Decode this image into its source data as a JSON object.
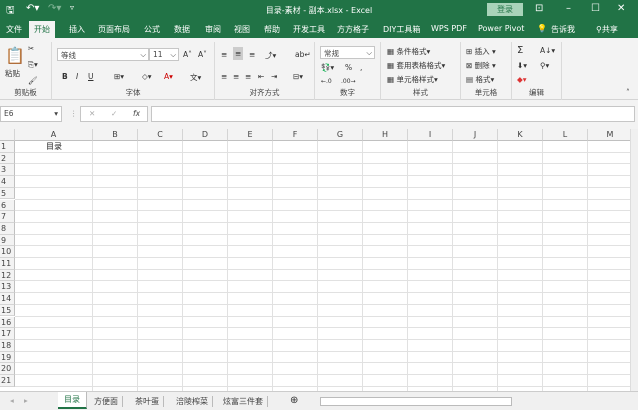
{
  "title": "目录-素材 - 副本.xlsx  -  Excel",
  "login": "登录",
  "menu_tabs": [
    "文件",
    "开始",
    "插入",
    "页面布局",
    "公式",
    "数据",
    "审阅",
    "视图",
    "帮助",
    "开发工具",
    "方方格子",
    "DIY工具箱",
    "WPS PDF",
    "Power Pivot"
  ],
  "tell_me": "告诉我",
  "share": "共享",
  "ribbon": {
    "clipboard": {
      "label": "剪贴板",
      "paste": "粘贴"
    },
    "font": {
      "label": "字体",
      "name": "等线",
      "size": "11",
      "bold": "B",
      "italic": "I",
      "underline": "U"
    },
    "alignment": {
      "label": "对齐方式"
    },
    "number": {
      "label": "数字",
      "format": "常规",
      "percent": "%"
    },
    "styles": {
      "label": "样式",
      "items": [
        "条件格式",
        "套用表格格式",
        "单元格样式"
      ]
    },
    "cells": {
      "label": "单元格",
      "items": [
        "插入",
        "删除",
        "格式"
      ]
    },
    "editing": {
      "label": "编辑",
      "sum": "Σ"
    }
  },
  "name_box": "E6",
  "fx": "fx",
  "formula": "",
  "columns": [
    "A",
    "B",
    "C",
    "D",
    "E",
    "F",
    "G",
    "H",
    "I",
    "J",
    "K",
    "L",
    "M"
  ],
  "rows": [
    "1",
    "2",
    "3",
    "4",
    "5",
    "6",
    "7",
    "8",
    "9",
    "10",
    "11",
    "12",
    "13",
    "14",
    "15",
    "16",
    "17",
    "18",
    "19",
    "20",
    "21"
  ],
  "cells": {
    "A1": "目录"
  },
  "sheets": [
    "目录",
    "方便面",
    "茶叶蛋",
    "涪陵榨菜",
    "炫富三件套"
  ],
  "active_sheet": "目录",
  "accent": "#217346"
}
